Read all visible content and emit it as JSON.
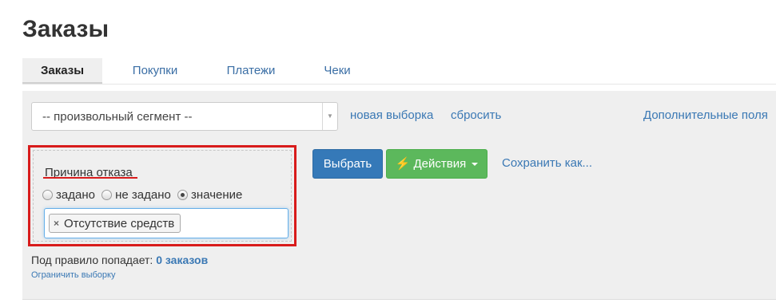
{
  "page": {
    "title": "Заказы"
  },
  "tabs": [
    {
      "label": "Заказы",
      "active": true
    },
    {
      "label": "Покупки",
      "active": false
    },
    {
      "label": "Платежи",
      "active": false
    },
    {
      "label": "Чеки",
      "active": false
    }
  ],
  "segment": {
    "value": "-- произвольный сегмент --",
    "arrow_icon": "triangle-down"
  },
  "links": {
    "new_selection": "новая выборка",
    "reset": "сбросить",
    "extra_fields": "Дополнительные поля",
    "save_as": "Сохранить как..."
  },
  "rule": {
    "title": "Причина отказа",
    "options": [
      {
        "label": "задано",
        "checked": false
      },
      {
        "label": "не задано",
        "checked": false
      },
      {
        "label": "значение",
        "checked": true
      }
    ],
    "tags": [
      "Отсутствие средств"
    ],
    "highlight_color": "#d81b1b"
  },
  "actions": {
    "select_label": "Выбрать",
    "actions_label": "Действия",
    "actions_icon": "lightning-icon"
  },
  "summary": {
    "prefix": "Под правило попадает:",
    "count": "0 заказов",
    "limit_link": "Ограничить выборку"
  },
  "colors": {
    "primary": "#3579b8",
    "success": "#5cb85c",
    "link": "#3a78b4"
  }
}
